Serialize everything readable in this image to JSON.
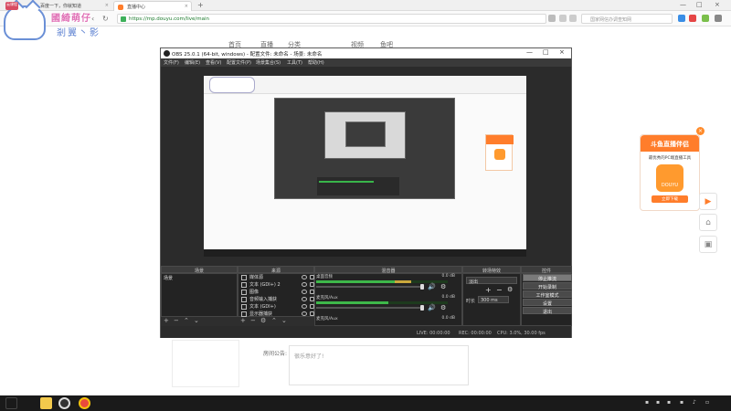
{
  "browser": {
    "tabs": [
      {
        "title": "百度一下，你就知道",
        "close": "×"
      },
      {
        "title": "直播中心",
        "close": "×"
      }
    ],
    "new_tab": "+",
    "url": "https://mp.douyu.com/live/main",
    "search_placeholder": "国家网信办调查知网",
    "window_controls": [
      "—",
      "□",
      "×"
    ]
  },
  "sticker": {
    "line1": "國綺萌仔",
    "line2": "剎翼丶影",
    "hat": "云课程"
  },
  "site": {
    "nav": [
      "首页",
      "直播",
      "分类",
      "视频",
      "鱼吧"
    ],
    "notice_label": "房间公告:",
    "notice_text": "很乐意好了!"
  },
  "promo": {
    "header": "斗鱼直播伴侣",
    "desc": "最优秀的PC端直播工具",
    "logo": "DOUYU",
    "button": "立即下载",
    "close": "×",
    "side_icons": [
      "play-icon",
      "home-icon",
      "image-icon"
    ],
    "accent": "#ff7d2b"
  },
  "obs": {
    "title": "OBS 25.0.1 (64-bit, windows) - 配置文件: 未命名 - 场景: 未命名",
    "menu": [
      "文件(F)",
      "编辑(E)",
      "查看(V)",
      "配置文件(P)",
      "场景集合(S)",
      "工具(T)",
      "帮助(H)"
    ],
    "docks": {
      "scenes": {
        "title": "场景",
        "items": [
          "场景"
        ]
      },
      "sources": {
        "title": "来源",
        "items": [
          "媒体源",
          "文本 (GDI+) 2",
          "图像",
          "音频输入捕获",
          "文本 (GDI+)",
          "显示器捕获"
        ]
      },
      "mixer": {
        "title": "混音器",
        "channels": [
          {
            "name": "桌面音频",
            "db": "0.0 dB",
            "level": 0.72
          },
          {
            "name": "麦克风/Aux",
            "db": "0.0 dB",
            "level": 0.55
          },
          {
            "name": "麦克风/Aux",
            "db": "0.0 dB",
            "level": 0.0
          }
        ]
      },
      "transitions": {
        "title": "转场特效",
        "type": "淡出",
        "duration_label": "时长",
        "duration": "300 ms"
      },
      "controls": {
        "title": "控件",
        "buttons": [
          "停止推流",
          "开始录制",
          "工作室模式",
          "设置",
          "退出"
        ]
      }
    },
    "status": {
      "live": "LIVE: 00:00:00",
      "rec": "REC: 00:00:00",
      "cpu": "CPU: 3.0%, 30.00 fps"
    }
  },
  "taskbar": {
    "items": [
      "start",
      "explorer",
      "obs",
      "chrome"
    ]
  }
}
